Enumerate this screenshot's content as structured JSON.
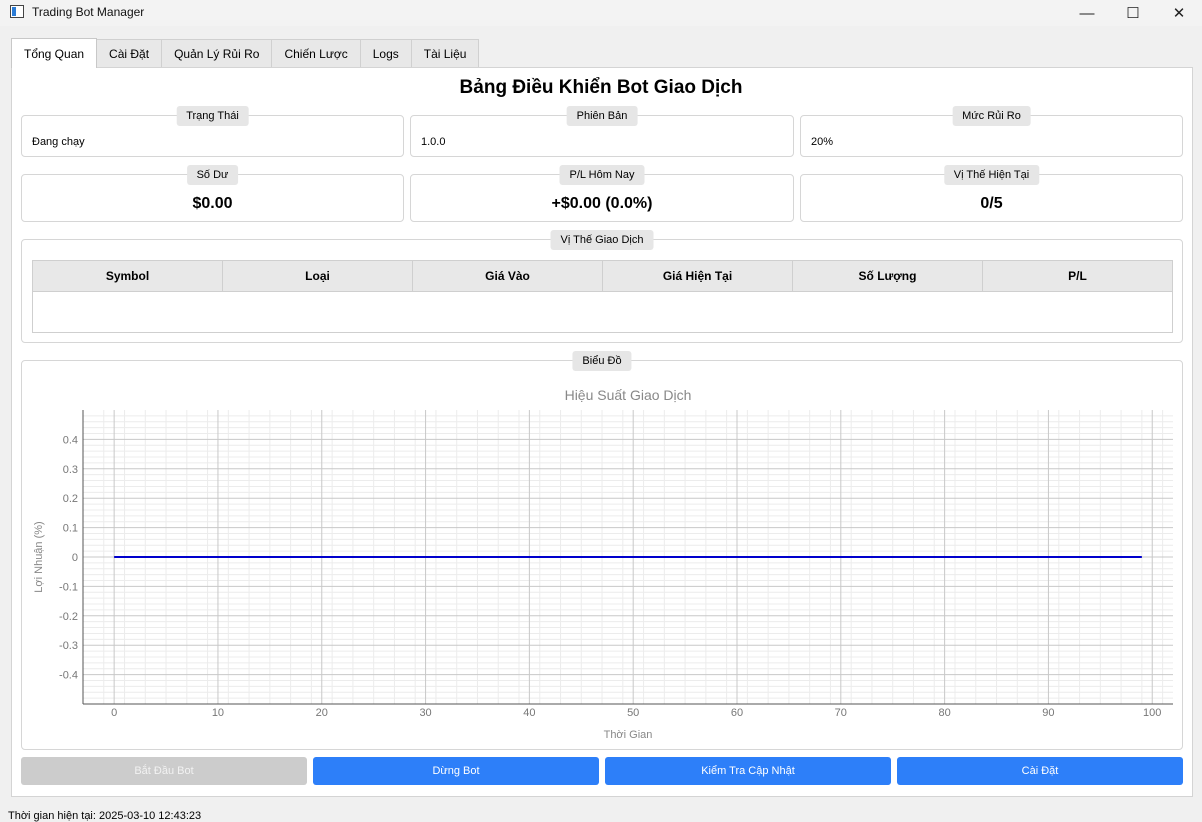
{
  "window": {
    "title": "Trading Bot Manager"
  },
  "tabs": [
    "Tổng Quan",
    "Cài Đặt",
    "Quản Lý Rủi Ro",
    "Chiến Lược",
    "Logs",
    "Tài Liệu"
  ],
  "dashboard": {
    "title": "Bảng Điều Khiển Bot Giao Dịch",
    "status": {
      "label": "Trạng Thái",
      "value": "Đang chạy"
    },
    "version": {
      "label": "Phiên Bản",
      "value": "1.0.0"
    },
    "risk_level": {
      "label": "Mức Rủi Ro",
      "value": "20%"
    },
    "balance": {
      "label": "Số Dư",
      "value": "$0.00"
    },
    "pl_today": {
      "label": "P/L Hôm Nay",
      "value": "+$0.00 (0.0%)"
    },
    "current_positions": {
      "label": "Vị Thế Hiện Tại",
      "value": "0/5"
    }
  },
  "positions": {
    "label": "Vị Thế Giao Dịch",
    "columns": [
      "Symbol",
      "Loại",
      "Giá Vào",
      "Giá Hiện Tại",
      "Số Lượng",
      "P/L"
    ],
    "rows": []
  },
  "chart_group": {
    "label": "Biểu Đồ"
  },
  "chart_data": {
    "type": "line",
    "title": "Hiệu Suất Giao Dịch",
    "xlabel": "Thời Gian",
    "ylabel": "Lợi Nhuận (%)",
    "xlim": [
      -3,
      102
    ],
    "ylim": [
      -0.5,
      0.5
    ],
    "xticks": [
      0,
      10,
      20,
      30,
      40,
      50,
      60,
      70,
      80,
      90,
      100
    ],
    "yticks": [
      0.4,
      0.3,
      0.2,
      0.1,
      0,
      -0.1,
      -0.2,
      -0.3,
      -0.4
    ],
    "grid": true,
    "series": [
      {
        "x": [
          0,
          99
        ],
        "y": [
          0,
          0
        ],
        "color": "#0000cc"
      }
    ]
  },
  "buttons": {
    "start": "Bắt Đầu Bot",
    "stop": "Dừng Bot",
    "check_update": "Kiểm Tra Cập Nhật",
    "settings": "Cài Đặt"
  },
  "status_bar": {
    "time": "Thời gian hiện tại: 2025-03-10 12:43:23"
  },
  "colors": {
    "accent": "#2d7ff9",
    "line": "#0000cc"
  }
}
